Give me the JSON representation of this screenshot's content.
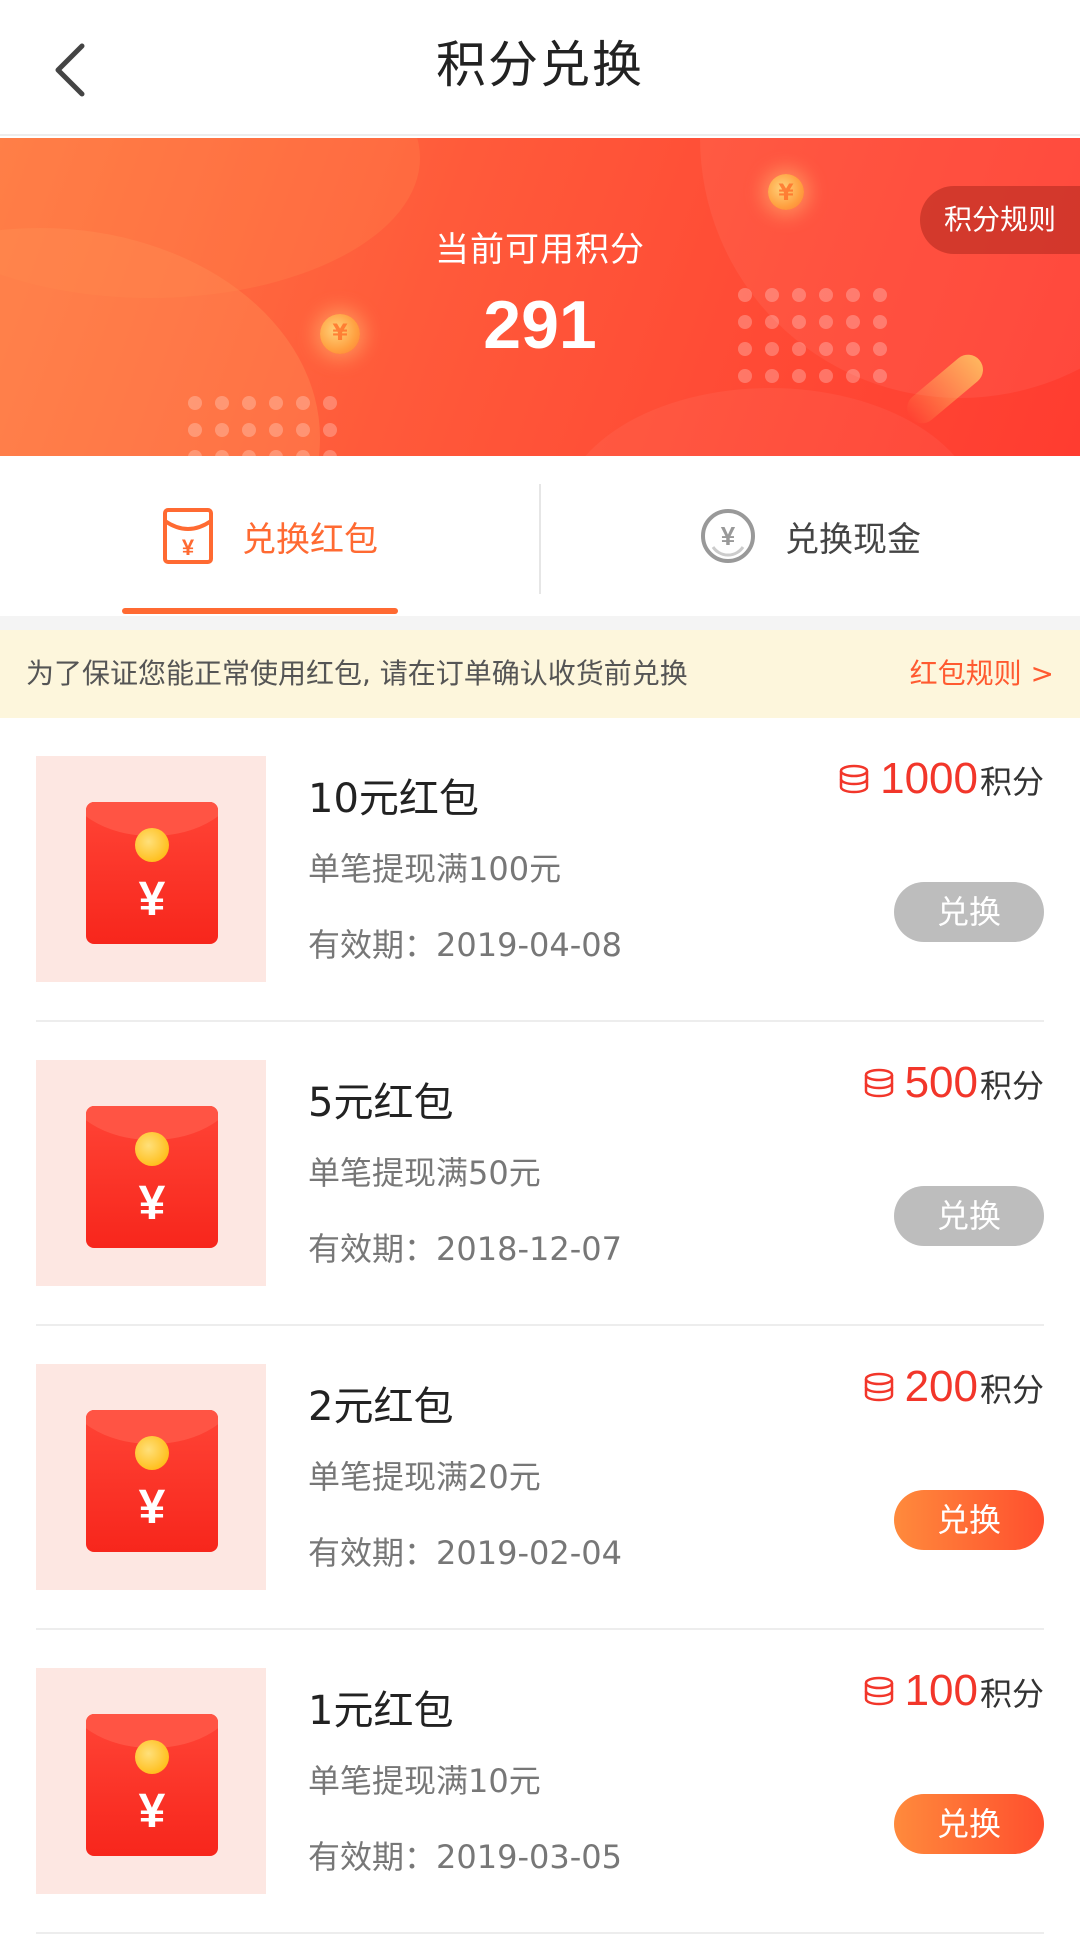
{
  "header": {
    "title": "积分兑换",
    "back_icon": "chevron-left-icon"
  },
  "banner": {
    "rules_label": "积分规则",
    "available_label": "当前可用积分",
    "available_points": "291",
    "colors": {
      "gradient_start": "#ff7a44",
      "gradient_end": "#ff3c30"
    }
  },
  "tabs": [
    {
      "label": "兑换红包",
      "icon": "red-envelope-icon",
      "selected": true
    },
    {
      "label": "兑换现金",
      "icon": "yen-circle-icon",
      "selected": false
    }
  ],
  "notice": {
    "text": "为了保证您能正常使用红包, 请在订单确认收货前兑换",
    "link": "红包规则 >"
  },
  "items": [
    {
      "name": "10元红包",
      "condition": "单笔提现满100元",
      "validity": "有效期：2019-04-08",
      "points": "1000",
      "points_unit": "积分",
      "button": "兑换",
      "enabled": false
    },
    {
      "name": "5元红包",
      "condition": "单笔提现满50元",
      "validity": "有效期：2018-12-07",
      "points": "500",
      "points_unit": "积分",
      "button": "兑换",
      "enabled": false
    },
    {
      "name": "2元红包",
      "condition": "单笔提现满20元",
      "validity": "有效期：2019-02-04",
      "points": "200",
      "points_unit": "积分",
      "button": "兑换",
      "enabled": true
    },
    {
      "name": "1元红包",
      "condition": "单笔提现满10元",
      "validity": "有效期：2019-03-05",
      "points": "100",
      "points_unit": "积分",
      "button": "兑换",
      "enabled": true
    }
  ],
  "colors": {
    "accent": "#ff6a32",
    "points_red": "#f2362a",
    "disabled_button": "#bdbdbd",
    "notice_bg": "#fdf6dc"
  }
}
